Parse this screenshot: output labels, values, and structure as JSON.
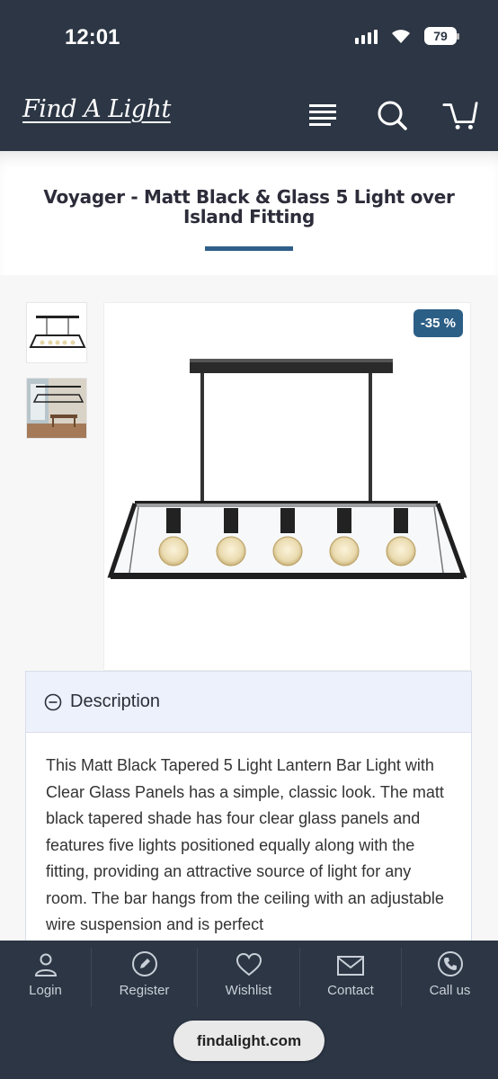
{
  "status_bar": {
    "time": "12:01",
    "battery": "79"
  },
  "header": {
    "logo": "Find A Light"
  },
  "product": {
    "title": "Voyager - Matt Black & Glass 5 Light over Island Fitting",
    "discount_badge": "-35 %"
  },
  "description": {
    "heading": "Description",
    "text": "This Matt Black Tapered 5 Light Lantern Bar Light with Clear Glass Panels has a simple, classic look. The matt black tapered shade has four clear glass panels and features five lights positioned equally along with the fitting, providing an attractive source of light for any room. The bar hangs from the ceiling with an adjustable wire suspension and is perfect"
  },
  "bottom_nav": {
    "items": [
      {
        "label": "Login",
        "icon": "user-icon"
      },
      {
        "label": "Register",
        "icon": "pencil-icon"
      },
      {
        "label": "Wishlist",
        "icon": "heart-icon"
      },
      {
        "label": "Contact",
        "icon": "mail-icon"
      },
      {
        "label": "Call us",
        "icon": "phone-icon"
      }
    ]
  },
  "browser": {
    "url": "findalight.com"
  },
  "colors": {
    "header_bg": "#2c3644",
    "accent": "#2f5f88",
    "badge": "#2c5f86"
  }
}
